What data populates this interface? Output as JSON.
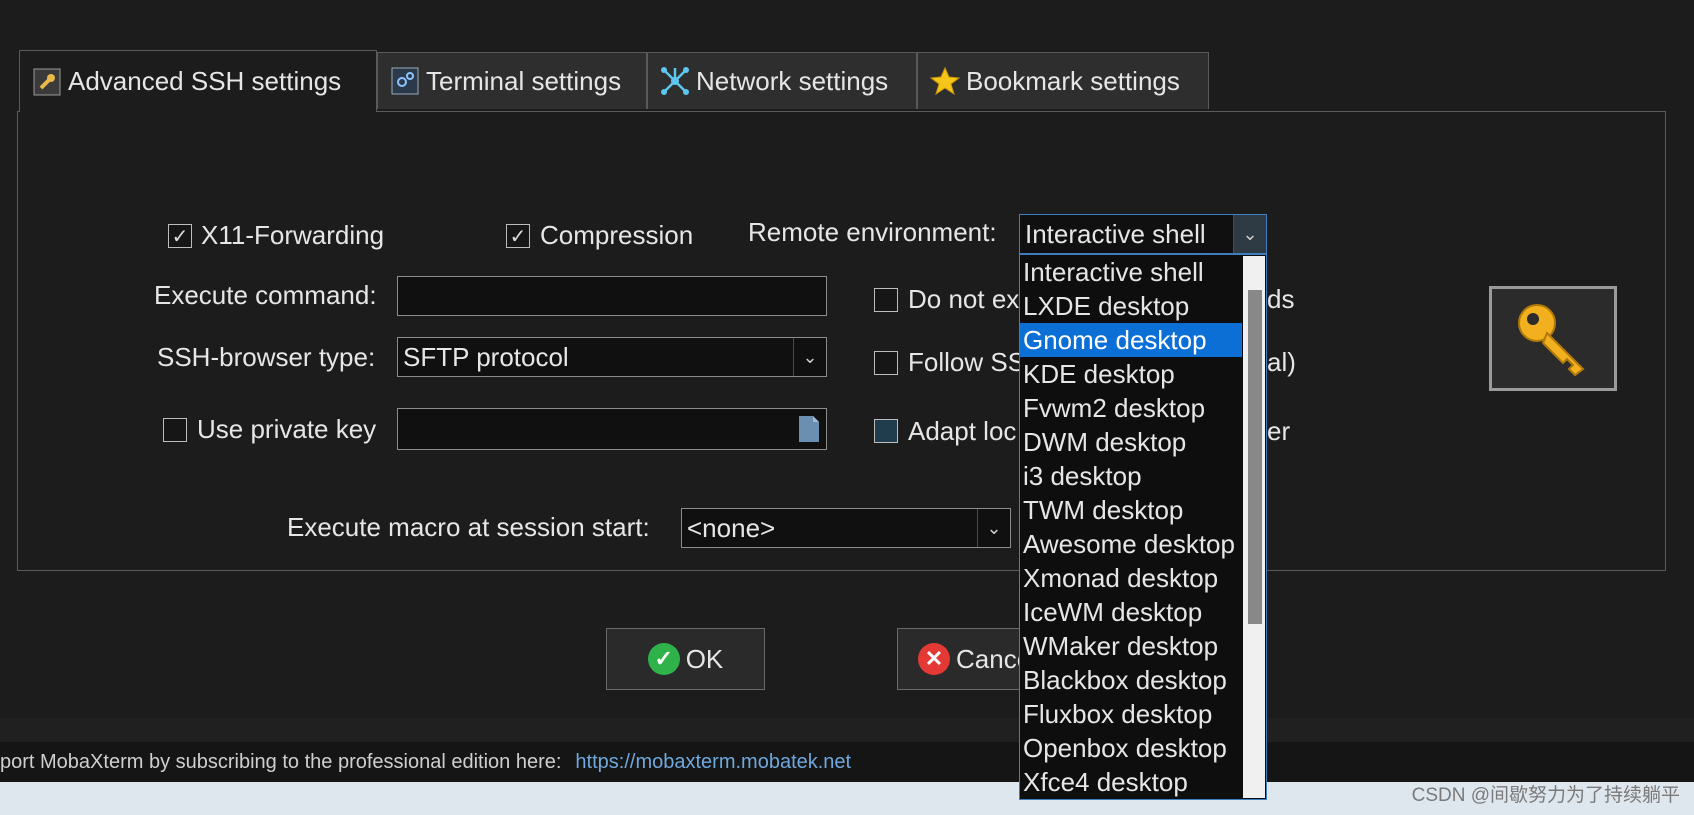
{
  "tabs": [
    {
      "label": "Advanced SSH settings",
      "icon": "wrench-icon"
    },
    {
      "label": "Terminal settings",
      "icon": "terminal-gear-icon"
    },
    {
      "label": "Network settings",
      "icon": "network-icon"
    },
    {
      "label": "Bookmark settings",
      "icon": "star-icon"
    }
  ],
  "options": {
    "x11_label": "X11-Forwarding",
    "x11_checked": true,
    "compression_label": "Compression",
    "compression_checked": true,
    "remote_env_label": "Remote environment:",
    "remote_env_value": "Interactive shell",
    "execute_command_label": "Execute command:",
    "execute_command_value": "",
    "ssh_browser_label": "SSH-browser type:",
    "ssh_browser_value": "SFTP protocol",
    "private_key_label": "Use private key",
    "private_key_checked": false,
    "private_key_value": "",
    "do_not_exit_label": "Do not ex",
    "do_not_exit_tail": "ds",
    "follow_label": "Follow SS",
    "follow_tail": "al)",
    "adapt_label": "Adapt loc",
    "adapt_tail": "er",
    "macro_label": "Execute macro at session start:",
    "macro_value": "<none>"
  },
  "dropdown": {
    "items": [
      "Interactive shell",
      "LXDE desktop",
      "Gnome desktop",
      "KDE desktop",
      "Fvwm2 desktop",
      "DWM desktop",
      "i3 desktop",
      "TWM desktop",
      "Awesome desktop",
      "Xmonad desktop",
      "IceWM desktop",
      "WMaker desktop",
      "Blackbox desktop",
      "Fluxbox desktop",
      "Openbox desktop",
      "Xfce4 desktop"
    ],
    "highlighted": "Gnome desktop"
  },
  "buttons": {
    "ok": "OK",
    "cancel": "Cance"
  },
  "status": {
    "text": "port MobaXterm by subscribing to the professional edition here:",
    "link": "https://mobaxterm.mobatek.net"
  },
  "watermark": "CSDN @间歇努力为了持续躺平",
  "colors": {
    "accent": "#0b6fd6",
    "ok_green": "#2fb24a",
    "cancel_red": "#e53935",
    "link": "#6fa8dc"
  }
}
